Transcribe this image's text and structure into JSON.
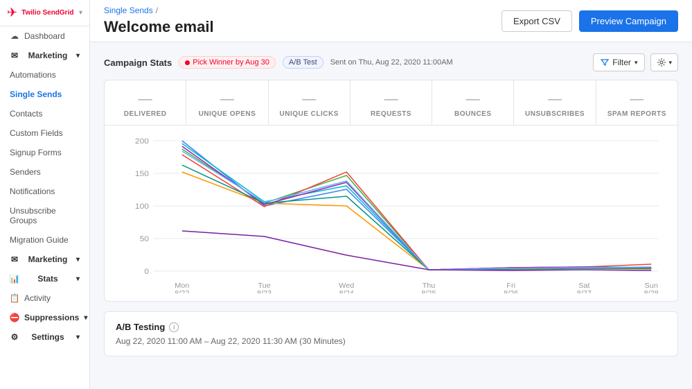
{
  "sidebar": {
    "logo": "Twilio SendGrid",
    "items": [
      {
        "id": "dashboard",
        "label": "Dashboard",
        "icon": "☁",
        "type": "main"
      },
      {
        "id": "marketing",
        "label": "Marketing",
        "icon": "✉",
        "type": "section",
        "expanded": true
      },
      {
        "id": "automations",
        "label": "Automations",
        "type": "sub"
      },
      {
        "id": "single-sends",
        "label": "Single Sends",
        "type": "sub",
        "active": true
      },
      {
        "id": "contacts",
        "label": "Contacts",
        "type": "sub"
      },
      {
        "id": "custom-fields",
        "label": "Custom Fields",
        "type": "sub"
      },
      {
        "id": "signup-forms",
        "label": "Signup Forms",
        "type": "sub"
      },
      {
        "id": "senders",
        "label": "Senders",
        "type": "sub"
      },
      {
        "id": "notifications",
        "label": "Notifications",
        "type": "sub"
      },
      {
        "id": "unsubscribe-groups",
        "label": "Unsubscribe Groups",
        "type": "sub"
      },
      {
        "id": "migration-guide",
        "label": "Migration Guide",
        "type": "sub"
      },
      {
        "id": "marketing2",
        "label": "Marketing",
        "icon": "✉",
        "type": "section"
      },
      {
        "id": "stats",
        "label": "Stats",
        "icon": "📊",
        "type": "section"
      },
      {
        "id": "activity",
        "label": "Activity",
        "icon": "📋",
        "type": "main"
      },
      {
        "id": "suppressions",
        "label": "Suppressions",
        "icon": "🚫",
        "type": "section"
      },
      {
        "id": "settings",
        "label": "Settings",
        "icon": "⚙",
        "type": "section"
      }
    ]
  },
  "header": {
    "breadcrumb_link": "Single Sends",
    "breadcrumb_separator": "/",
    "page_title": "Welcome email",
    "export_btn": "Export CSV",
    "preview_btn": "Preview Campaign"
  },
  "campaign_stats": {
    "title": "Campaign Stats",
    "badge_pick_winner": "Pick Winner by Aug 30",
    "badge_ab": "A/B Test",
    "badge_sent": "Sent on Thu, Aug 22, 2020 11:00AM",
    "filter_btn": "Filter",
    "stats": [
      {
        "label": "DELIVERED",
        "value": "—"
      },
      {
        "label": "UNIQUE OPENS",
        "value": "—"
      },
      {
        "label": "UNIQUE CLICKS",
        "value": "—"
      },
      {
        "label": "REQUESTS",
        "value": "—"
      },
      {
        "label": "BOUNCES",
        "value": "—"
      },
      {
        "label": "UNSUBSCRIBES",
        "value": "—"
      },
      {
        "label": "SPAM REPORTS",
        "value": "—"
      }
    ]
  },
  "chart": {
    "x_labels": [
      {
        "day": "Mon",
        "date": "8/22"
      },
      {
        "day": "Tue",
        "date": "8/23"
      },
      {
        "day": "Wed",
        "date": "8/24"
      },
      {
        "day": "Thu",
        "date": "8/25"
      },
      {
        "day": "Fri",
        "date": "8/26"
      },
      {
        "day": "Sat",
        "date": "8/27"
      },
      {
        "day": "Sun",
        "date": "8/28"
      }
    ],
    "y_labels": [
      "200",
      "150",
      "100",
      "50",
      "0"
    ]
  },
  "ab_testing": {
    "title": "A/B Testing",
    "time_range": "Aug 22, 2020 11:00 AM – Aug 22, 2020 11:30 AM (30 Minutes)"
  }
}
